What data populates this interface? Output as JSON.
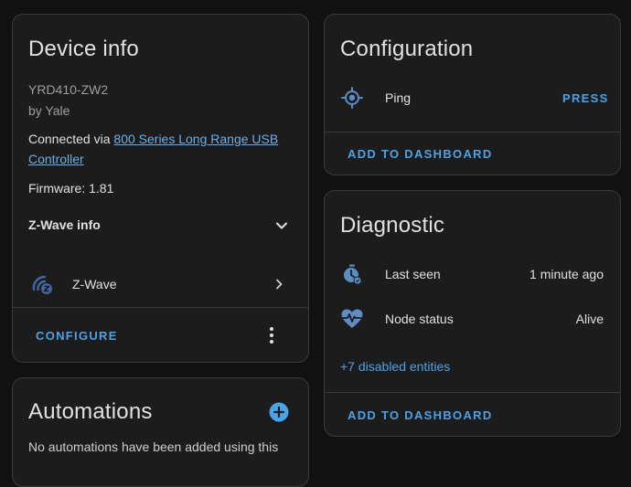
{
  "colors": {
    "background": "#111111",
    "card": "#1c1c1c",
    "border": "#3a3a3a",
    "accent": "#4aa3e6",
    "icon": "#5c8ec6",
    "text": "#e1e1e1",
    "muted": "#9e9e9e"
  },
  "device_info": {
    "title": "Device info",
    "model": "YRD410-ZW2",
    "manufacturer": "by Yale",
    "connected_prefix": "Connected via ",
    "connected_link_line1": "800 Series Long Range USB",
    "connected_link_line2": "Controller",
    "firmware": "Firmware: 1.81",
    "zwave_info_label": "Z-Wave info",
    "zwave_label": "Z-Wave",
    "configure_label": "CONFIGURE"
  },
  "automations": {
    "title": "Automations",
    "partial_text": "No automations have been added using this"
  },
  "configuration": {
    "title": "Configuration",
    "ping_label": "Ping",
    "press_label": "PRESS",
    "add_to_dashboard_label": "ADD TO DASHBOARD"
  },
  "diagnostic": {
    "title": "Diagnostic",
    "last_seen_label": "Last seen",
    "last_seen_value": "1 minute ago",
    "node_status_label": "Node status",
    "node_status_value": "Alive",
    "disabled_entities_label": "+7 disabled entities",
    "add_to_dashboard_label": "ADD TO DASHBOARD"
  }
}
